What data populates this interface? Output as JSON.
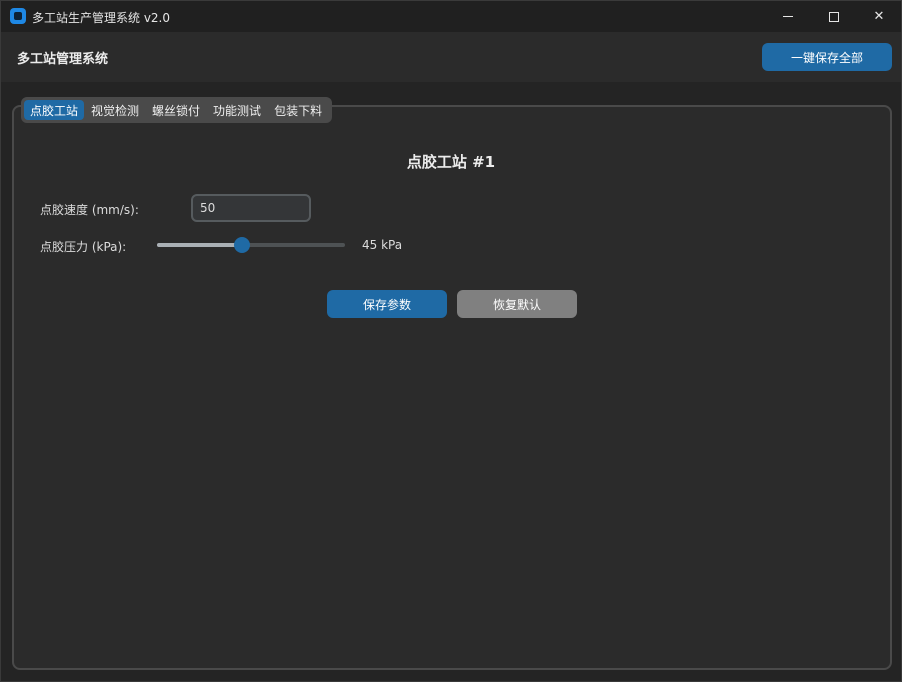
{
  "window": {
    "title": "多工站生产管理系统 v2.0"
  },
  "header": {
    "title": "多工站管理系统",
    "save_all_label": "一键保存全部"
  },
  "tabs": [
    {
      "label": "点胶工站",
      "active": true
    },
    {
      "label": "视觉检测",
      "active": false
    },
    {
      "label": "螺丝锁付",
      "active": false
    },
    {
      "label": "功能测试",
      "active": false
    },
    {
      "label": "包装下料",
      "active": false
    }
  ],
  "station": {
    "title": "点胶工站 #1",
    "speed_label": "点胶速度 (mm/s):",
    "speed_value": "50",
    "pressure_label": "点胶压力 (kPa):",
    "pressure_value_text": "45 kPa",
    "pressure_fraction": 0.45,
    "save_label": "保存参数",
    "reset_label": "恢复默认"
  },
  "colors": {
    "accent": "#1f6aa5",
    "secondary_button": "#808080"
  }
}
